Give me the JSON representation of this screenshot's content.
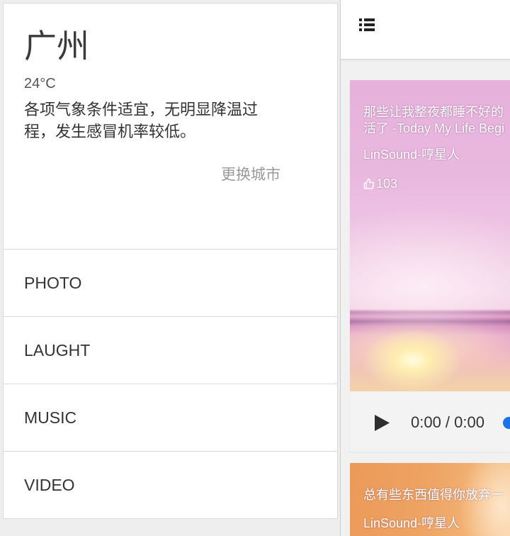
{
  "drawer": {
    "weather": {
      "city": "广州",
      "temperature": "24°C",
      "description": "各项气象条件适宜，无明显降温过程，发生感冒机率较低。",
      "change_city_label": "更换城市"
    },
    "menu": [
      {
        "label": "PHOTO"
      },
      {
        "label": "LAUGHT"
      },
      {
        "label": "MUSIC"
      },
      {
        "label": "VIDEO"
      }
    ]
  },
  "header": {
    "menu_icon": "list-icon"
  },
  "feed": [
    {
      "title_lines": [
        "那些让我整夜都睡不好的",
        "活了 -Today My Life Begi"
      ],
      "author": "LinSound-哼星人",
      "like_icon": "thumbs-up-icon",
      "likes": "103",
      "player": {
        "play_icon": "play-icon",
        "time": "0:00 / 0:00"
      }
    },
    {
      "title_lines": [
        "总有些东西值得你放弃一"
      ],
      "author": "LinSound-哼星人"
    }
  ],
  "colors": {
    "accent": "#1a73e8",
    "background": "#eeeeee",
    "text_primary": "#333333",
    "text_secondary": "#999999"
  }
}
